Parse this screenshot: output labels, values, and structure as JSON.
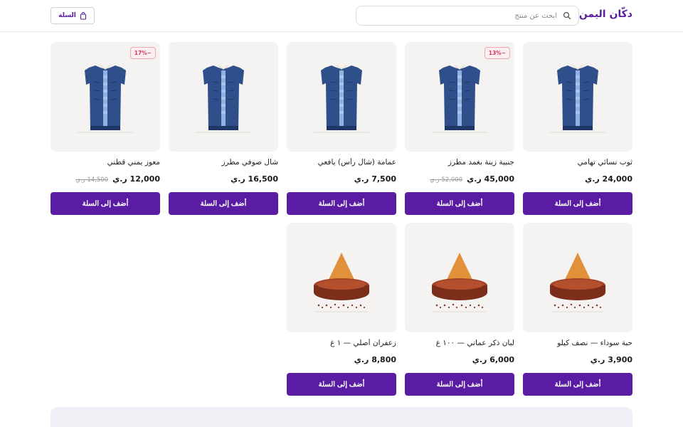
{
  "header": {
    "logo": "دكّان اليمن",
    "search_placeholder": "ابحث عن منتج",
    "cart_label": "السلة"
  },
  "colors": {
    "brand": "#5a1ca3",
    "badge": "#d1385a",
    "thumb_bg": "#f4f3f1"
  },
  "add_label": "أضف إلى السلة",
  "products": [
    {
      "name": "ثوب نسائي تهامي",
      "price": "24,000 ر.ي",
      "old_price": "",
      "badge": "",
      "icon": "dress-icon"
    },
    {
      "name": "جنبية زينة بغمد مطرز",
      "price": "45,000 ر.ي",
      "old_price": "52,000 ر.ي",
      "badge": "13%−",
      "icon": "dress-icon"
    },
    {
      "name": "عمامة (شال رأس) يافعي",
      "price": "7,500 ر.ي",
      "old_price": "",
      "badge": "",
      "icon": "dress-icon"
    },
    {
      "name": "شال صوفي مطرز",
      "price": "16,500 ر.ي",
      "old_price": "",
      "badge": "",
      "icon": "dress-icon"
    },
    {
      "name": "معوز يمني قطني",
      "price": "12,000 ر.ي",
      "old_price": "14,500 ر.ي",
      "badge": "17%−",
      "icon": "dress-icon"
    },
    {
      "name": "حبة سوداء — نصف كيلو",
      "price": "3,900 ر.ي",
      "old_price": "",
      "badge": "",
      "icon": "spice-icon"
    },
    {
      "name": "لبان ذكر عماني — ١٠٠ غ",
      "price": "6,000 ر.ي",
      "old_price": "",
      "badge": "",
      "icon": "spice-icon"
    },
    {
      "name": "زعفران أصلي — ١ غ",
      "price": "8,800 ر.ي",
      "old_price": "",
      "badge": "",
      "icon": "spice-icon"
    }
  ]
}
